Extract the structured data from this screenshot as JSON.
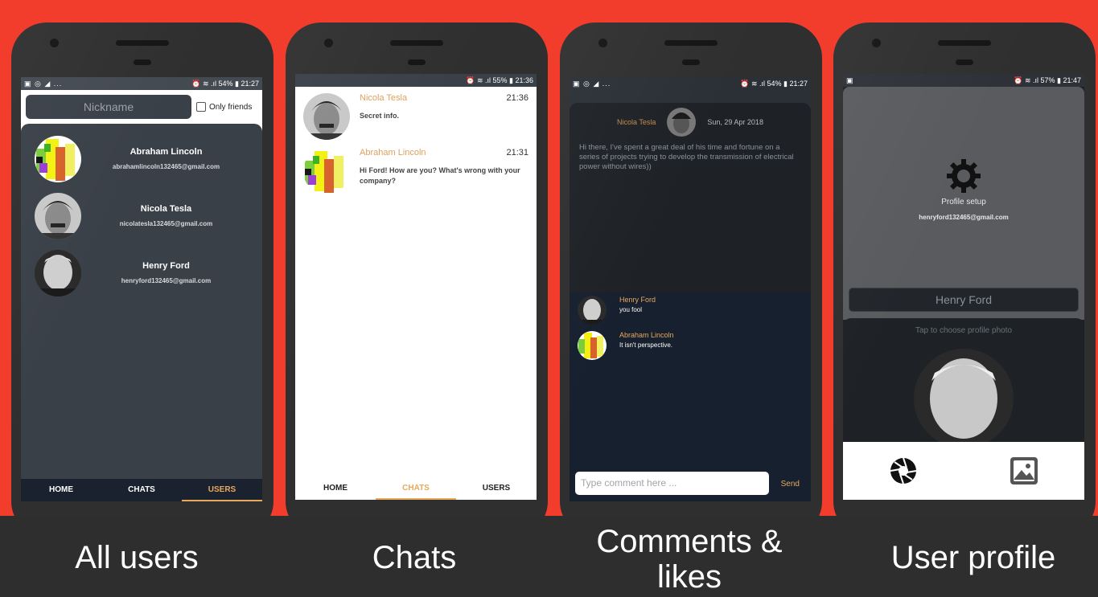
{
  "captions": [
    "All users",
    "Chats",
    "Comments & likes",
    "User profile"
  ],
  "screen1": {
    "status_left": "▣ ◎ ◢ ...",
    "status_right": "⏰ ≋ .ıl 54% ▮ 21:27",
    "search_placeholder": "Nickname",
    "only_friends_label": "Only friends",
    "users": [
      {
        "name": "Abraham Lincoln",
        "email": "abrahamlincoln132465@gmail.com"
      },
      {
        "name": "Nicola Tesla",
        "email": "nicolatesla132465@gmail.com"
      },
      {
        "name": "Henry Ford",
        "email": "henryford132465@gmail.com"
      }
    ],
    "tabs": [
      "HOME",
      "CHATS",
      "USERS"
    ]
  },
  "screen2": {
    "status_right": "⏰ ≋ .ıl 55% ▮ 21:36",
    "chats": [
      {
        "name": "Nicola Tesla",
        "time": "21:36",
        "message": "Secret info."
      },
      {
        "name": "Abraham Lincoln",
        "time": "21:31",
        "message_line1": "Hi Ford! How are you? What's wrong with your",
        "message_line2": "company?"
      }
    ],
    "tabs": [
      "HOME",
      "CHATS",
      "USERS"
    ]
  },
  "screen3": {
    "status_left": "▣ ◎ ◢ ...",
    "status_right": "⏰ ≋ .ıl 54% ▮ 21:27",
    "post_author": "Nicola Tesla",
    "post_date": "Sun, 29 Apr 2018",
    "post_text": "Hi there, I've spent a great deal of his time and fortune on a series of projects trying to develop the transmission of electrical power without wires))",
    "comments": [
      {
        "name": "Henry Ford",
        "text": "you fool"
      },
      {
        "name": "Abraham Lincoln",
        "text": "It isn't perspective."
      }
    ],
    "comment_placeholder": "Type comment here ...",
    "send_label": "Send"
  },
  "screen4": {
    "status_left": "▣",
    "status_right": "⏰ ≋ .ıl 57% ▮ 21:47",
    "profile_setup_label": "Profile setup",
    "email": "henryford132465@gmail.com",
    "name_value": "Henry Ford",
    "tap_hint": "Tap to choose profile photo"
  },
  "colors": {
    "background": "#f23c2c",
    "accent": "#e8a95c",
    "dark_panel": "#3a4048"
  }
}
